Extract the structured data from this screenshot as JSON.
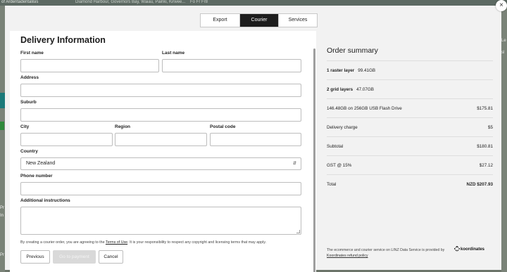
{
  "background": {
    "top_left_text": "of Ardentadentalisis",
    "breadcrumb": "Diamond Harbour, Governors Bay, Waiau, Pairiki, Kirwee...",
    "top_cols": "Fo   Fr   Fr8",
    "left_snippets": [
      "Pr",
      "In",
      "Pr"
    ],
    "right_snippets": [
      "Le",
      "sl"
    ]
  },
  "modal": {
    "close_label": "×",
    "tabs": [
      {
        "label": "Export",
        "active": false
      },
      {
        "label": "Courier",
        "active": true
      },
      {
        "label": "Services",
        "active": false
      }
    ]
  },
  "form": {
    "title": "Delivery Information",
    "labels": {
      "first_name": "First name",
      "last_name": "Last name",
      "address": "Address",
      "suburb": "Suburb",
      "city": "City",
      "region": "Region",
      "postal_code": "Postal code",
      "country": "Country",
      "phone": "Phone number",
      "instructions": "Additional instructions"
    },
    "values": {
      "first_name": "",
      "last_name": "",
      "address": "",
      "suburb": "",
      "city": "",
      "region": "",
      "postal_code": "",
      "phone": "",
      "instructions": ""
    },
    "country_selected": "New Zealand",
    "terms_before": "By creating a courier order, you are agreeing to the ",
    "terms_link": "Terms of Use",
    "terms_after": ". It is your responsibility to respect any copyright and licensing terms that may apply.",
    "buttons": {
      "previous": "Previous",
      "go_to_payment": "Go to payment",
      "cancel": "Cancel"
    }
  },
  "summary": {
    "title": "Order summary",
    "rows": [
      {
        "key_bold": "1 raster layer",
        "key": "99.41GB",
        "value": ""
      },
      {
        "key_bold": "2 grid layers",
        "key": "47.07GB",
        "value": ""
      },
      {
        "key_bold": "",
        "key": "146.48GB on 256GB USB Flash Drive",
        "value": "$175.81"
      },
      {
        "key_bold": "",
        "key": "Delivery charge",
        "value": "$5"
      },
      {
        "key_bold": "",
        "key": "Subtotal",
        "value": "$180.81"
      },
      {
        "key_bold": "",
        "key": "GST @ 15%",
        "value": "$27.12"
      },
      {
        "key_bold": "",
        "key": "Total",
        "value": "NZD $207.93",
        "value_bold": true
      }
    ],
    "footer_text": "The ecommerce and courier service on LINZ Data Service is provided by",
    "footer_link": "Koordinates refund policy",
    "brand_name": "koordinates"
  },
  "colors": {
    "active_tab": "#1d1d1d",
    "panel_bg": "#f2f2f2",
    "disabled_button": "#d9d9d9"
  }
}
